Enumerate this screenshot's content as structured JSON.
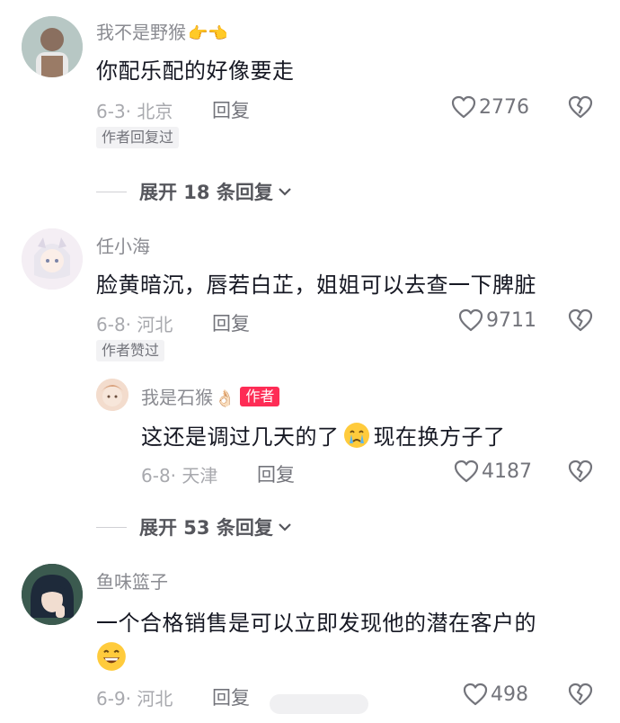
{
  "comments": [
    {
      "username": "我不是野猴",
      "username_emoji": "👉👈",
      "text": "你配乐配的好像要走",
      "meta": "6-3· 北京",
      "reply_label": "回复",
      "likes": "2776",
      "tag": "作者回复过"
    },
    {
      "username": "任小海",
      "text": "脸黄暗沉，唇若白芷，姐姐可以去查一下脾脏",
      "meta": "6-8· 河北",
      "reply_label": "回复",
      "likes": "9711",
      "tag": "作者赞过"
    },
    {
      "username": "鱼味篮子",
      "text": "一个合格销售是可以立即发现他的潜在客户的",
      "meta": "6-9· 河北",
      "reply_label": "回复",
      "likes": "498"
    }
  ],
  "reply": {
    "username": "我是石猴",
    "username_emoji": "👌🏻",
    "badge": "作者",
    "text_before": "这还是调过几天的了",
    "text_after": "现在换方子了",
    "meta": "6-8· 天津",
    "reply_label": "回复",
    "likes": "4187"
  },
  "expand_1": {
    "label": "展开 18 条回复"
  },
  "expand_2": {
    "label": "展开 53 条回复"
  },
  "colors": {
    "text": "#161823",
    "secondary": "#8a8b91",
    "author_badge": "#fe2c55",
    "tag_bg": "#f2f2f4"
  },
  "icons": [
    "heart-icon",
    "broken-heart-icon",
    "chevron-down-icon",
    "crying-emoji-icon",
    "grinning-emoji-icon"
  ]
}
